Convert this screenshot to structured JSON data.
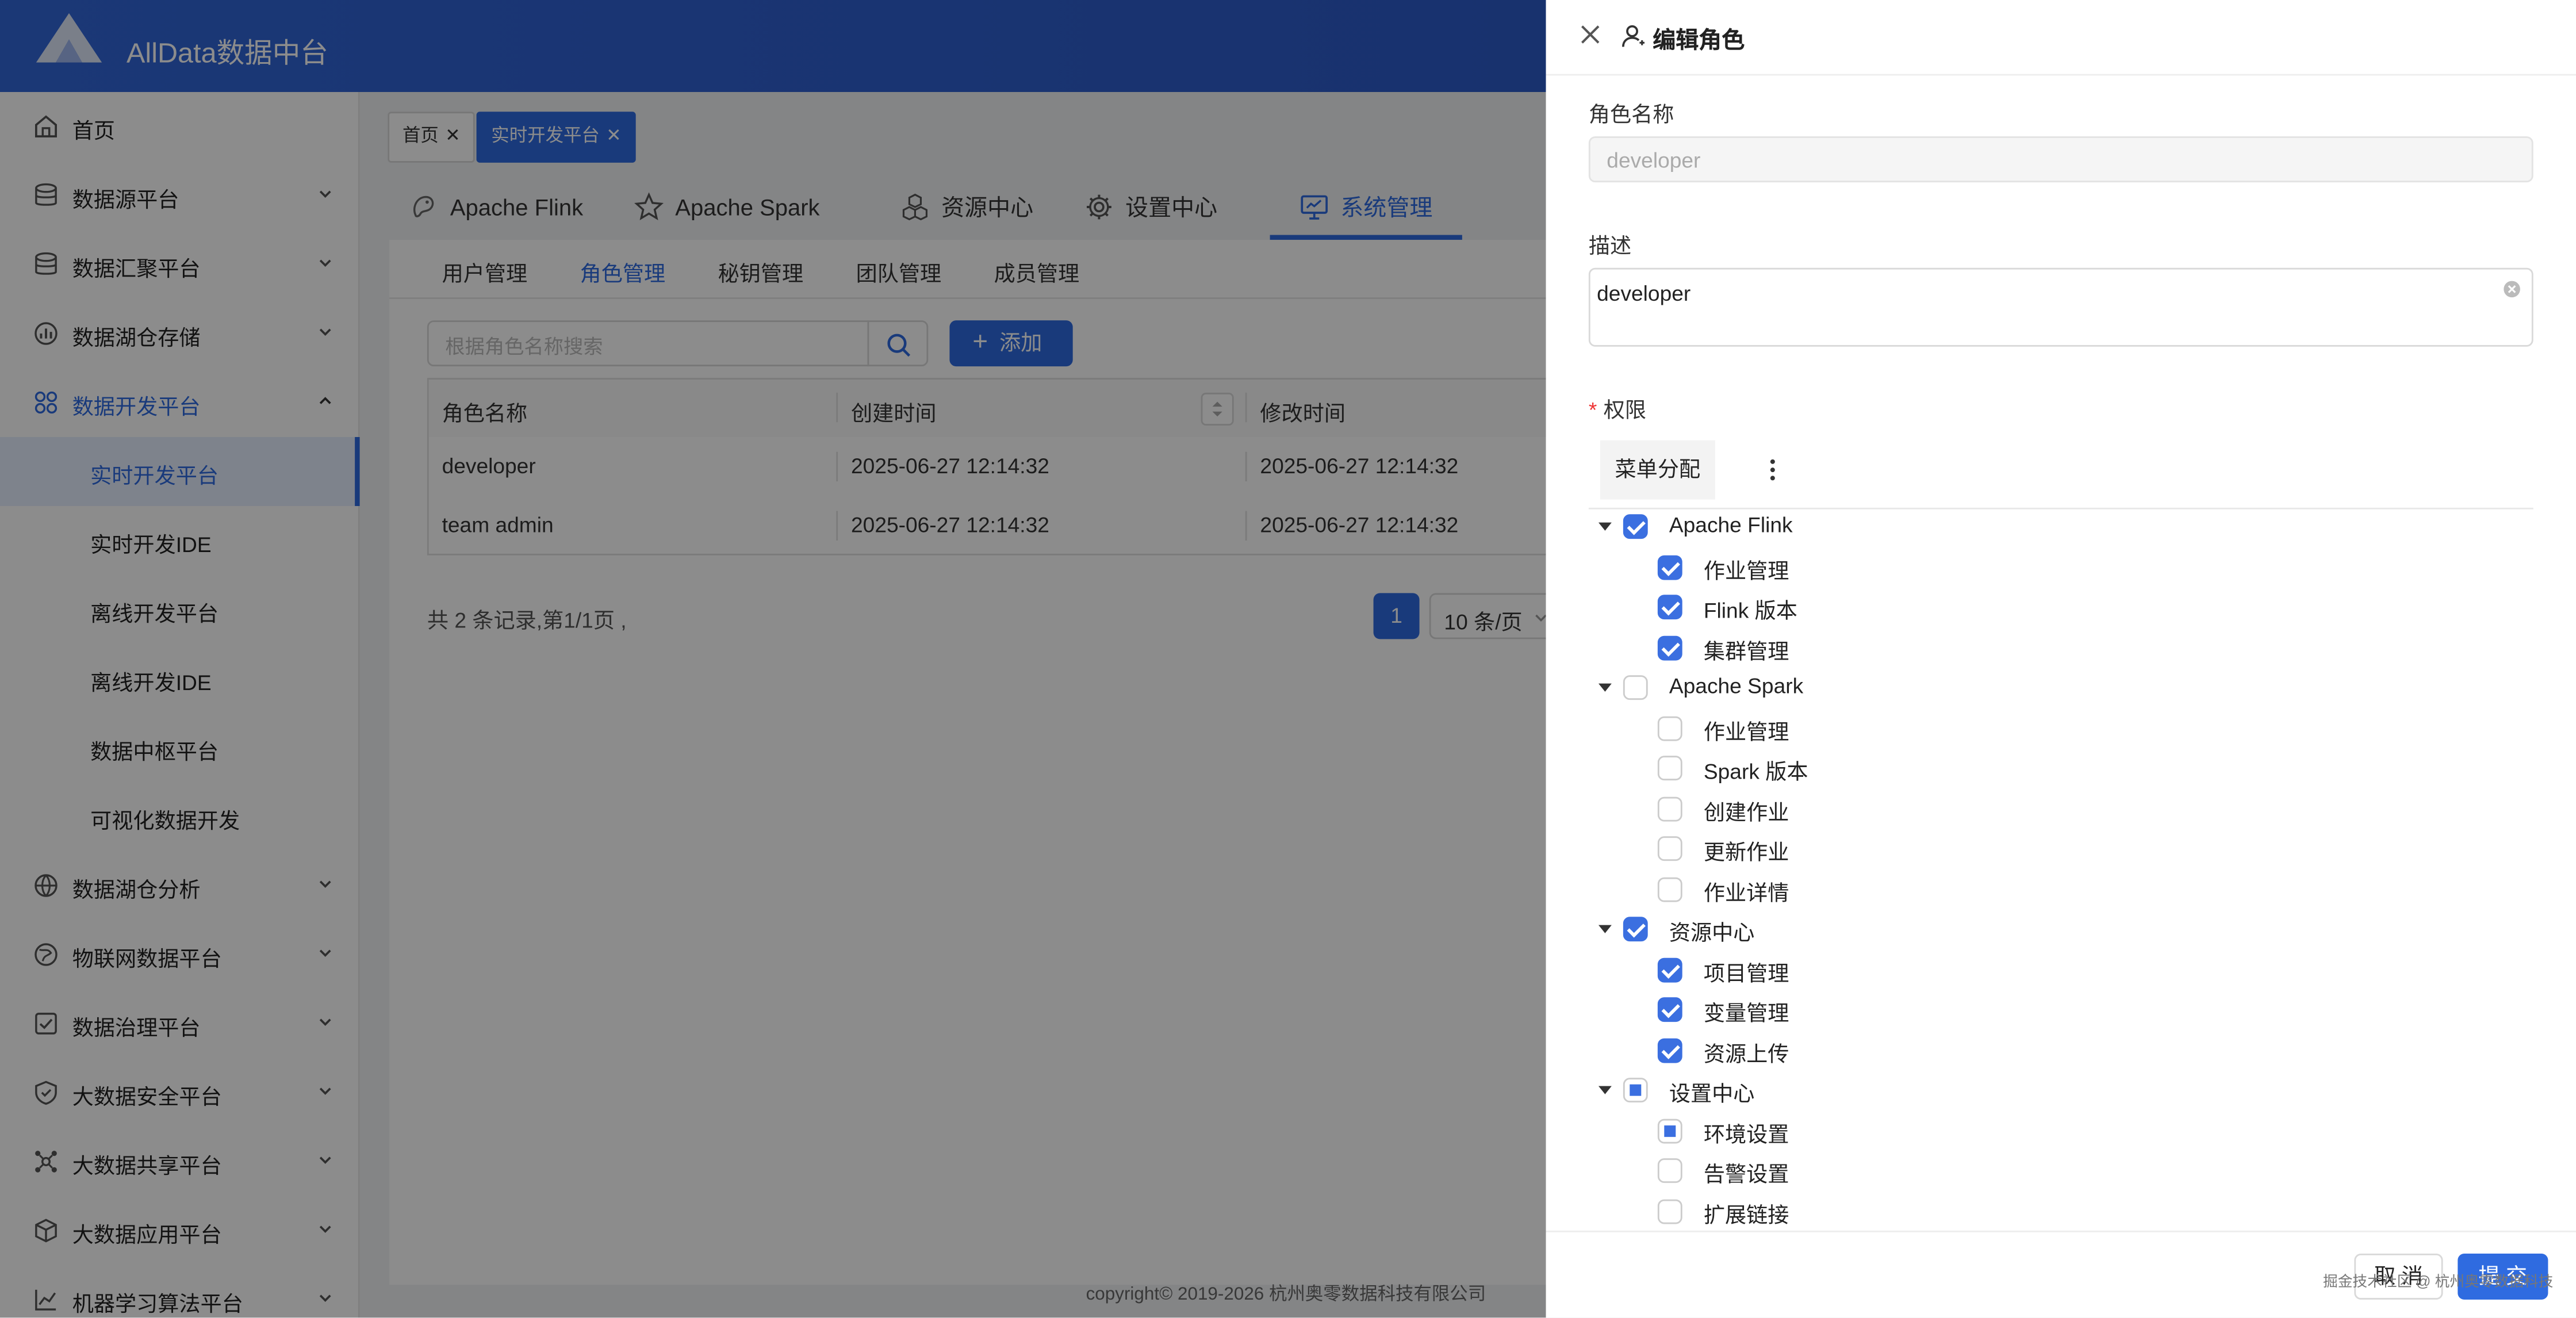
{
  "app": {
    "title": "AllData数据中台"
  },
  "sidebar": {
    "items": [
      {
        "label": "首页",
        "icon": "home-icon"
      },
      {
        "label": "数据源平台",
        "icon": "database-icon"
      },
      {
        "label": "数据汇聚平台",
        "icon": "database-icon"
      },
      {
        "label": "数据湖仓存储",
        "icon": "chart-icon"
      },
      {
        "label": "数据开发平台",
        "icon": "grid-icon"
      },
      {
        "label": "数据湖仓分析",
        "icon": "globe-icon"
      },
      {
        "label": "物联网数据平台",
        "icon": "globe-icon"
      },
      {
        "label": "数据治理平台",
        "icon": "check-square-icon"
      },
      {
        "label": "大数据安全平台",
        "icon": "shield-icon"
      },
      {
        "label": "大数据共享平台",
        "icon": "share-icon"
      },
      {
        "label": "大数据应用平台",
        "icon": "box-icon"
      },
      {
        "label": "机器学习算法平台",
        "icon": "chart-line-icon"
      }
    ],
    "sub_items": [
      "实时开发平台",
      "实时开发IDE",
      "离线开发平台",
      "离线开发IDE",
      "数据中枢平台",
      "可视化数据开发"
    ]
  },
  "tags": [
    {
      "label": "首页"
    },
    {
      "label": "实时开发平台"
    }
  ],
  "top_tabs": [
    {
      "label": "Apache Flink",
      "icon": "flink-icon"
    },
    {
      "label": "Apache Spark",
      "icon": "star-icon"
    },
    {
      "label": "资源中心",
      "icon": "cubes-icon"
    },
    {
      "label": "设置中心",
      "icon": "gear-icon"
    },
    {
      "label": "系统管理",
      "icon": "monitor-icon"
    }
  ],
  "sub_tabs": [
    "用户管理",
    "角色管理",
    "秘钥管理",
    "团队管理",
    "成员管理"
  ],
  "search": {
    "placeholder": "根据角色名称搜索"
  },
  "add_button": "添加",
  "table": {
    "headers": [
      "角色名称",
      "创建时间",
      "修改时间"
    ],
    "rows": [
      [
        "developer",
        "2025-06-27 12:14:32",
        "2025-06-27 12:14:32"
      ],
      [
        "team admin",
        "2025-06-27 12:14:32",
        "2025-06-27 12:14:32"
      ]
    ]
  },
  "pagination": {
    "total_text": "共 2 条记录,第1/1页 ,",
    "current": "1",
    "page_size": "10 条/页"
  },
  "copyright": "copyright© 2019-2026 杭州奥零数据科技有限公司",
  "drawer": {
    "title": "编辑角色",
    "name_label": "角色名称",
    "name_value": "developer",
    "desc_label": "描述",
    "desc_value": "developer",
    "perm_label": "权限",
    "perm_tab": "菜单分配",
    "tree": [
      {
        "label": "Apache Flink",
        "state": "checked",
        "level": 0,
        "caret": "down"
      },
      {
        "label": "作业管理",
        "state": "checked",
        "level": 1,
        "caret": "right"
      },
      {
        "label": "Flink 版本",
        "state": "checked",
        "level": 1,
        "caret": ""
      },
      {
        "label": "集群管理",
        "state": "checked",
        "level": 1,
        "caret": "right"
      },
      {
        "label": "Apache Spark",
        "state": "none",
        "level": 0,
        "caret": "down"
      },
      {
        "label": "作业管理",
        "state": "none",
        "level": 1,
        "caret": ""
      },
      {
        "label": "Spark 版本",
        "state": "none",
        "level": 1,
        "caret": ""
      },
      {
        "label": "创建作业",
        "state": "none",
        "level": 1,
        "caret": ""
      },
      {
        "label": "更新作业",
        "state": "none",
        "level": 1,
        "caret": ""
      },
      {
        "label": "作业详情",
        "state": "none",
        "level": 1,
        "caret": ""
      },
      {
        "label": "资源中心",
        "state": "checked",
        "level": 0,
        "caret": "down"
      },
      {
        "label": "项目管理",
        "state": "checked",
        "level": 1,
        "caret": "right"
      },
      {
        "label": "变量管理",
        "state": "checked",
        "level": 1,
        "caret": "right"
      },
      {
        "label": "资源上传",
        "state": "checked",
        "level": 1,
        "caret": "right"
      },
      {
        "label": "设置中心",
        "state": "partial",
        "level": 0,
        "caret": "down"
      },
      {
        "label": "环境设置",
        "state": "partial",
        "level": 1,
        "caret": "right"
      },
      {
        "label": "告警设置",
        "state": "none",
        "level": 1,
        "caret": ""
      },
      {
        "label": "扩展链接",
        "state": "none",
        "level": 1,
        "caret": "right"
      }
    ],
    "cancel_label": "取 消",
    "submit_label": "提 交",
    "watermark": "掘金技术社区 @ 杭州奥零数据科技"
  }
}
